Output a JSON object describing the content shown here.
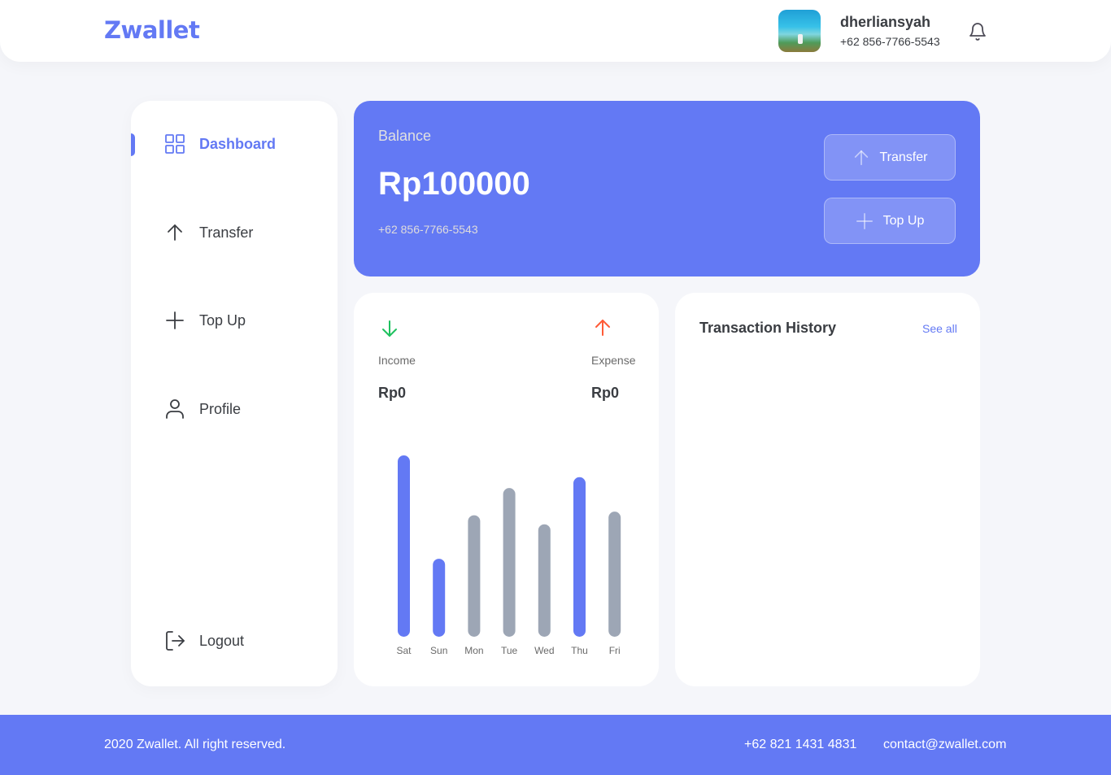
{
  "header": {
    "brand": "Zwallet",
    "user_name": "dherliansyah",
    "user_phone": "+62 856-7766-5543"
  },
  "sidebar": {
    "items": [
      {
        "label": "Dashboard",
        "icon": "grid-icon",
        "active": true
      },
      {
        "label": "Transfer",
        "icon": "arrow-up-icon",
        "active": false
      },
      {
        "label": "Top Up",
        "icon": "plus-icon",
        "active": false
      },
      {
        "label": "Profile",
        "icon": "user-icon",
        "active": false
      }
    ],
    "logout_label": "Logout"
  },
  "balance": {
    "label": "Balance",
    "amount": "Rp100000",
    "phone": "+62 856-7766-5543",
    "transfer_label": "Transfer",
    "topup_label": "Top Up"
  },
  "stats": {
    "income_label": "Income",
    "income_value": "Rp0",
    "expense_label": "Expense",
    "expense_value": "Rp0"
  },
  "chart_data": {
    "type": "bar",
    "categories": [
      "Sat",
      "Sun",
      "Mon",
      "Tue",
      "Wed",
      "Thu",
      "Fri"
    ],
    "values": [
      100,
      43,
      67,
      82,
      62,
      88,
      69
    ],
    "highlight": [
      true,
      true,
      false,
      false,
      false,
      true,
      false
    ],
    "colors": {
      "highlight": "#6379f4",
      "normal": "#9da6b5"
    },
    "title": "",
    "xlabel": "",
    "ylabel": ""
  },
  "transactions": {
    "title": "Transaction History",
    "see_all": "See all"
  },
  "footer": {
    "copyright": "2020 Zwallet. All right reserved.",
    "phone": "+62 821 1431 4831",
    "email": "contact@zwallet.com"
  },
  "colors": {
    "accent": "#6379f4",
    "income": "#1ec15f",
    "expense": "#ff5b37"
  }
}
